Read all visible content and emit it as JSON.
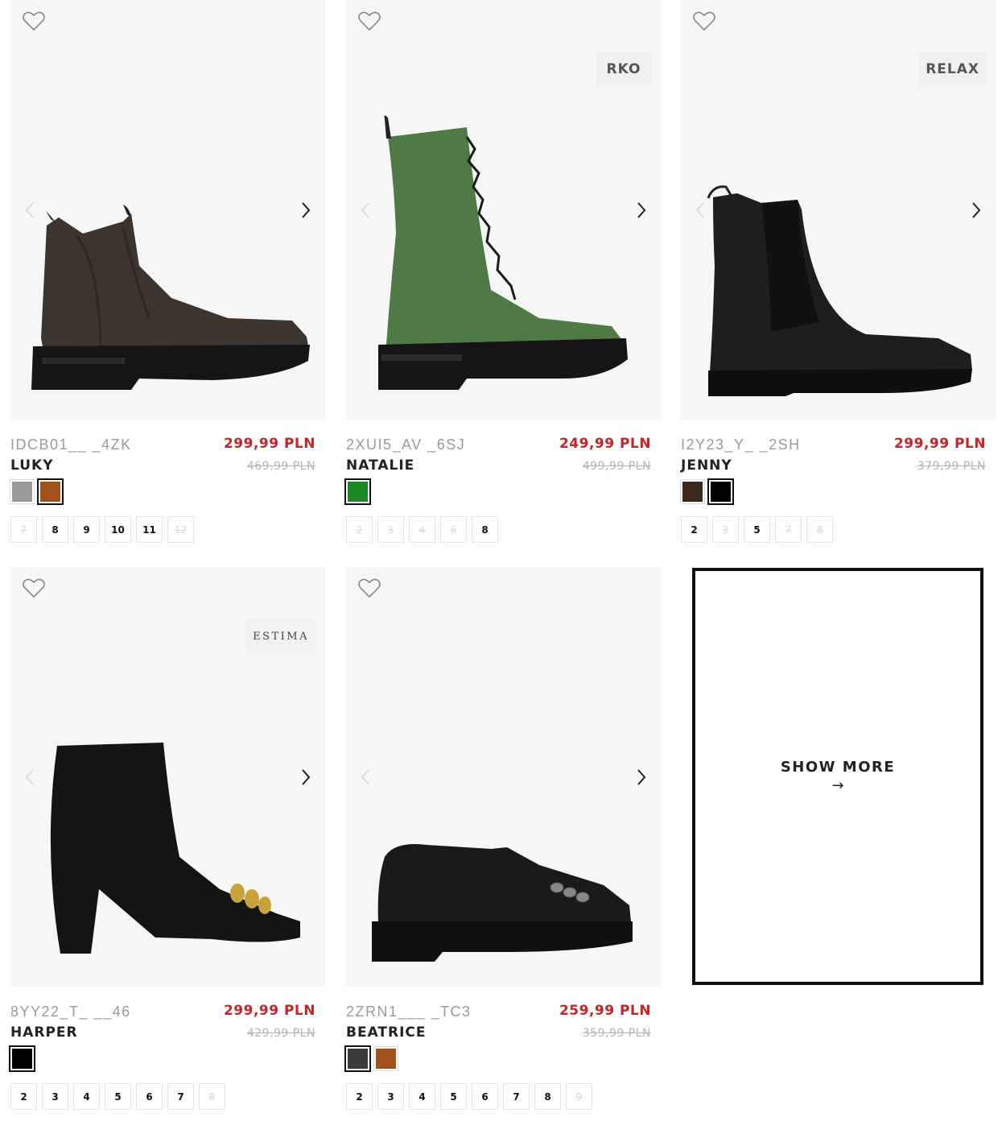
{
  "products": [
    {
      "code": "IDCB01__ _4ZK",
      "name": "LUKY",
      "price": "299,99 PLN",
      "old_price": "469,99 PLN",
      "brand": "",
      "swatches": [
        "#999999",
        "#a0521a"
      ],
      "selected_swatch": 1,
      "sizes": [
        {
          "label": "7",
          "available": false
        },
        {
          "label": "8",
          "available": true
        },
        {
          "label": "9",
          "available": true
        },
        {
          "label": "10",
          "available": true
        },
        {
          "label": "11",
          "available": true
        },
        {
          "label": "12",
          "available": false
        }
      ]
    },
    {
      "code": "2XUI5_AV _6SJ",
      "name": "NATALIE",
      "price": "249,99 PLN",
      "old_price": "499,99 PLN",
      "brand": "RKO",
      "swatches": [
        "#1a8a24"
      ],
      "selected_swatch": 0,
      "sizes": [
        {
          "label": "2",
          "available": false
        },
        {
          "label": "3",
          "available": false
        },
        {
          "label": "4",
          "available": false
        },
        {
          "label": "6",
          "available": false
        },
        {
          "label": "8",
          "available": true
        }
      ]
    },
    {
      "code": "I2Y23_Y_ _2SH",
      "name": "JENNY",
      "price": "299,99 PLN",
      "old_price": "379,99 PLN",
      "brand": "RELAX",
      "swatches": [
        "#3b2a1c",
        "#000000"
      ],
      "selected_swatch": 1,
      "sizes": [
        {
          "label": "2",
          "available": true
        },
        {
          "label": "3",
          "available": false
        },
        {
          "label": "5",
          "available": true
        },
        {
          "label": "7",
          "available": false
        },
        {
          "label": "8",
          "available": false
        }
      ]
    },
    {
      "code": "8YY22_T_ __46",
      "name": "HARPER",
      "price": "299,99 PLN",
      "old_price": "429,99 PLN",
      "brand": "ESTIMA",
      "swatches": [
        "#000000"
      ],
      "selected_swatch": 0,
      "sizes": [
        {
          "label": "2",
          "available": true
        },
        {
          "label": "3",
          "available": true
        },
        {
          "label": "4",
          "available": true
        },
        {
          "label": "5",
          "available": true
        },
        {
          "label": "6",
          "available": true
        },
        {
          "label": "7",
          "available": true
        },
        {
          "label": "8",
          "available": false
        }
      ]
    },
    {
      "code": "2ZRN1___ _TC3",
      "name": "BEATRICE",
      "price": "259,99 PLN",
      "old_price": "359,99 PLN",
      "brand": "",
      "swatches": [
        "#3a3a3a",
        "#a0521a"
      ],
      "selected_swatch": 0,
      "sizes": [
        {
          "label": "2",
          "available": true
        },
        {
          "label": "3",
          "available": true
        },
        {
          "label": "4",
          "available": true
        },
        {
          "label": "5",
          "available": true
        },
        {
          "label": "6",
          "available": true
        },
        {
          "label": "7",
          "available": true
        },
        {
          "label": "8",
          "available": true
        },
        {
          "label": "9",
          "available": false
        }
      ]
    }
  ],
  "show_more": {
    "label": "SHOW MORE",
    "arrow": "→"
  },
  "icons": {
    "wishlist": "heart-icon",
    "prev": "chevron-left-icon",
    "next": "chevron-right-icon"
  },
  "colors": {
    "price": "#c8232c",
    "old_price": "#b4b4b4",
    "image_bg": "#f6f6f6"
  }
}
